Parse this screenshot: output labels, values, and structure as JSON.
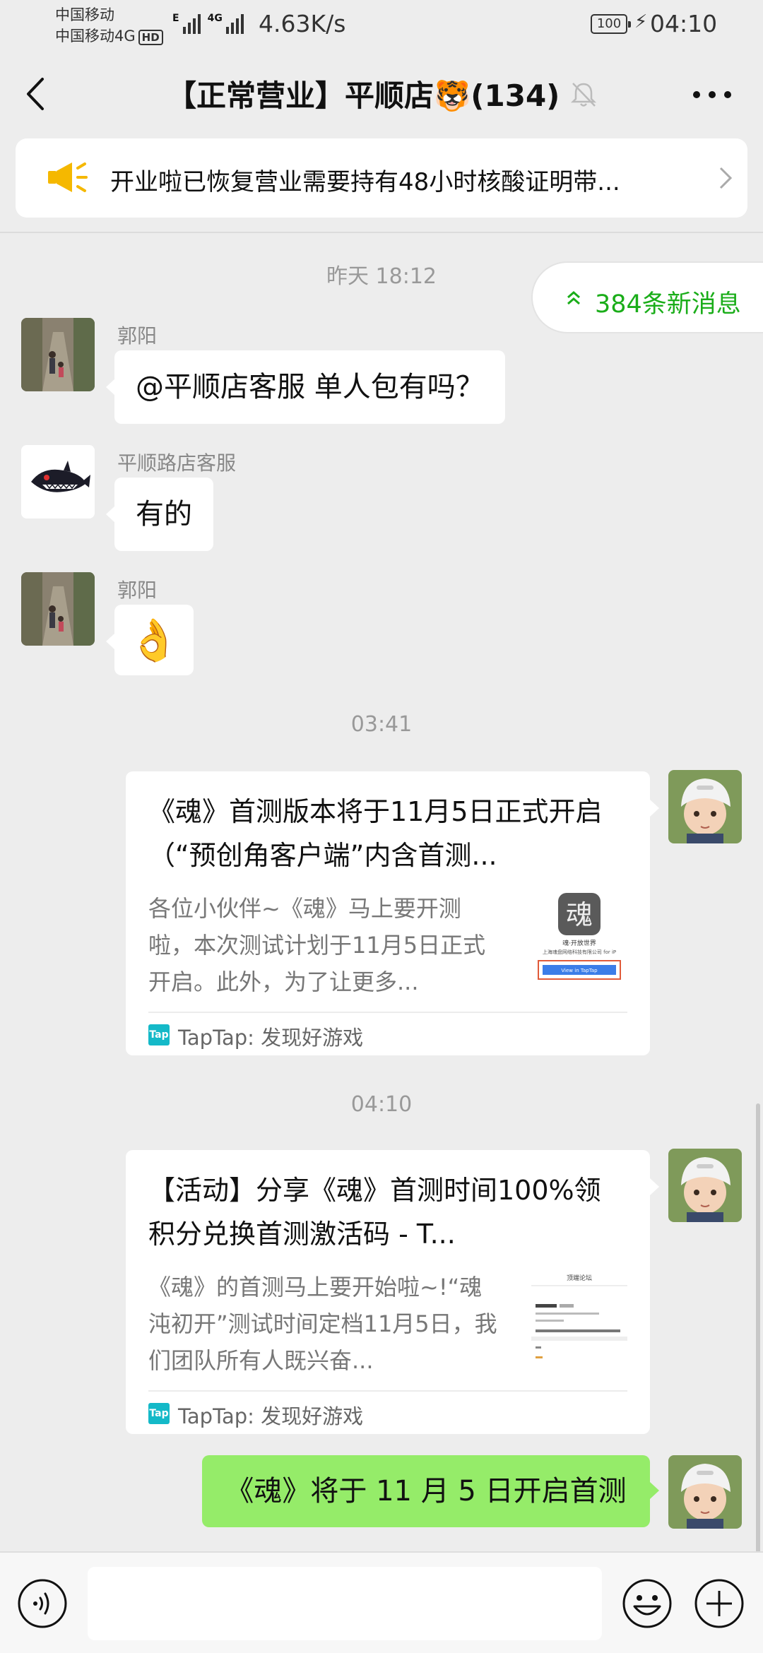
{
  "status_bar": {
    "carrier_1": "中国移动",
    "carrier_2": "中国移动4G",
    "hd_badge": "HD",
    "network_labels": [
      "E",
      "4G"
    ],
    "speed": "4.63K/s",
    "battery": "100",
    "time": "04:10"
  },
  "header": {
    "title": "【正常营业】平顺店🐯(134)",
    "icons": [
      "back-arrow-icon",
      "mute-bell-icon",
      "more-options-icon"
    ]
  },
  "announcement": {
    "text": "开业啦已恢复营业需要持有48小时核酸证明带...",
    "icon": "megaphone-icon"
  },
  "new_messages": {
    "label": "384条新消息"
  },
  "messages": [
    {
      "type": "timestamp",
      "text": "昨天 18:12"
    },
    {
      "type": "text",
      "sender": "郭阳",
      "text": "@平顺店客服  单人包有吗？"
    },
    {
      "type": "text",
      "sender": "平顺路店客服",
      "text": "有的"
    },
    {
      "type": "emoji",
      "sender": "郭阳",
      "emoji": "👌"
    },
    {
      "type": "timestamp",
      "text": "03:41"
    },
    {
      "type": "link-card",
      "title": "《魂》首测版本将于11月5日正式开启（“预创角客户端”内含首测...",
      "desc": "各位小伙伴~《魂》马上要开测啦，本次测试计划于11月5日正式开启。此外，为了让更多...",
      "source": "TapTap: 发现好游戏",
      "source_icon_text": "Tap",
      "thumb_text": [
        "魂",
        "魂·开放世界",
        "上海魂盘网络科技有限公司 for iP",
        "View in TapTap"
      ]
    },
    {
      "type": "timestamp",
      "text": "04:10"
    },
    {
      "type": "link-card",
      "title": "【活动】分享《魂》首测时间100%领积分兑换首测激活码 - T...",
      "desc": "《魂》的首测马上要开始啦~!“魂沌初开”测试时间定档11月5日，我们团队所有人既兴奋...",
      "source": "TapTap: 发现好游戏",
      "source_icon_text": "Tap",
      "thumb_text": [
        "顶端论坛"
      ]
    },
    {
      "type": "text",
      "sender": "me",
      "text": "《魂》将于 11 月 5 日开启首测"
    }
  ],
  "input_bar": {
    "placeholder": "",
    "icons": [
      "voice-icon",
      "emoji-icon",
      "plus-icon"
    ]
  },
  "colors": {
    "background": "#ededed",
    "bubble_self": "#95ec69",
    "accent_green": "#1aad19",
    "tap_icon": "#14b9c8"
  }
}
